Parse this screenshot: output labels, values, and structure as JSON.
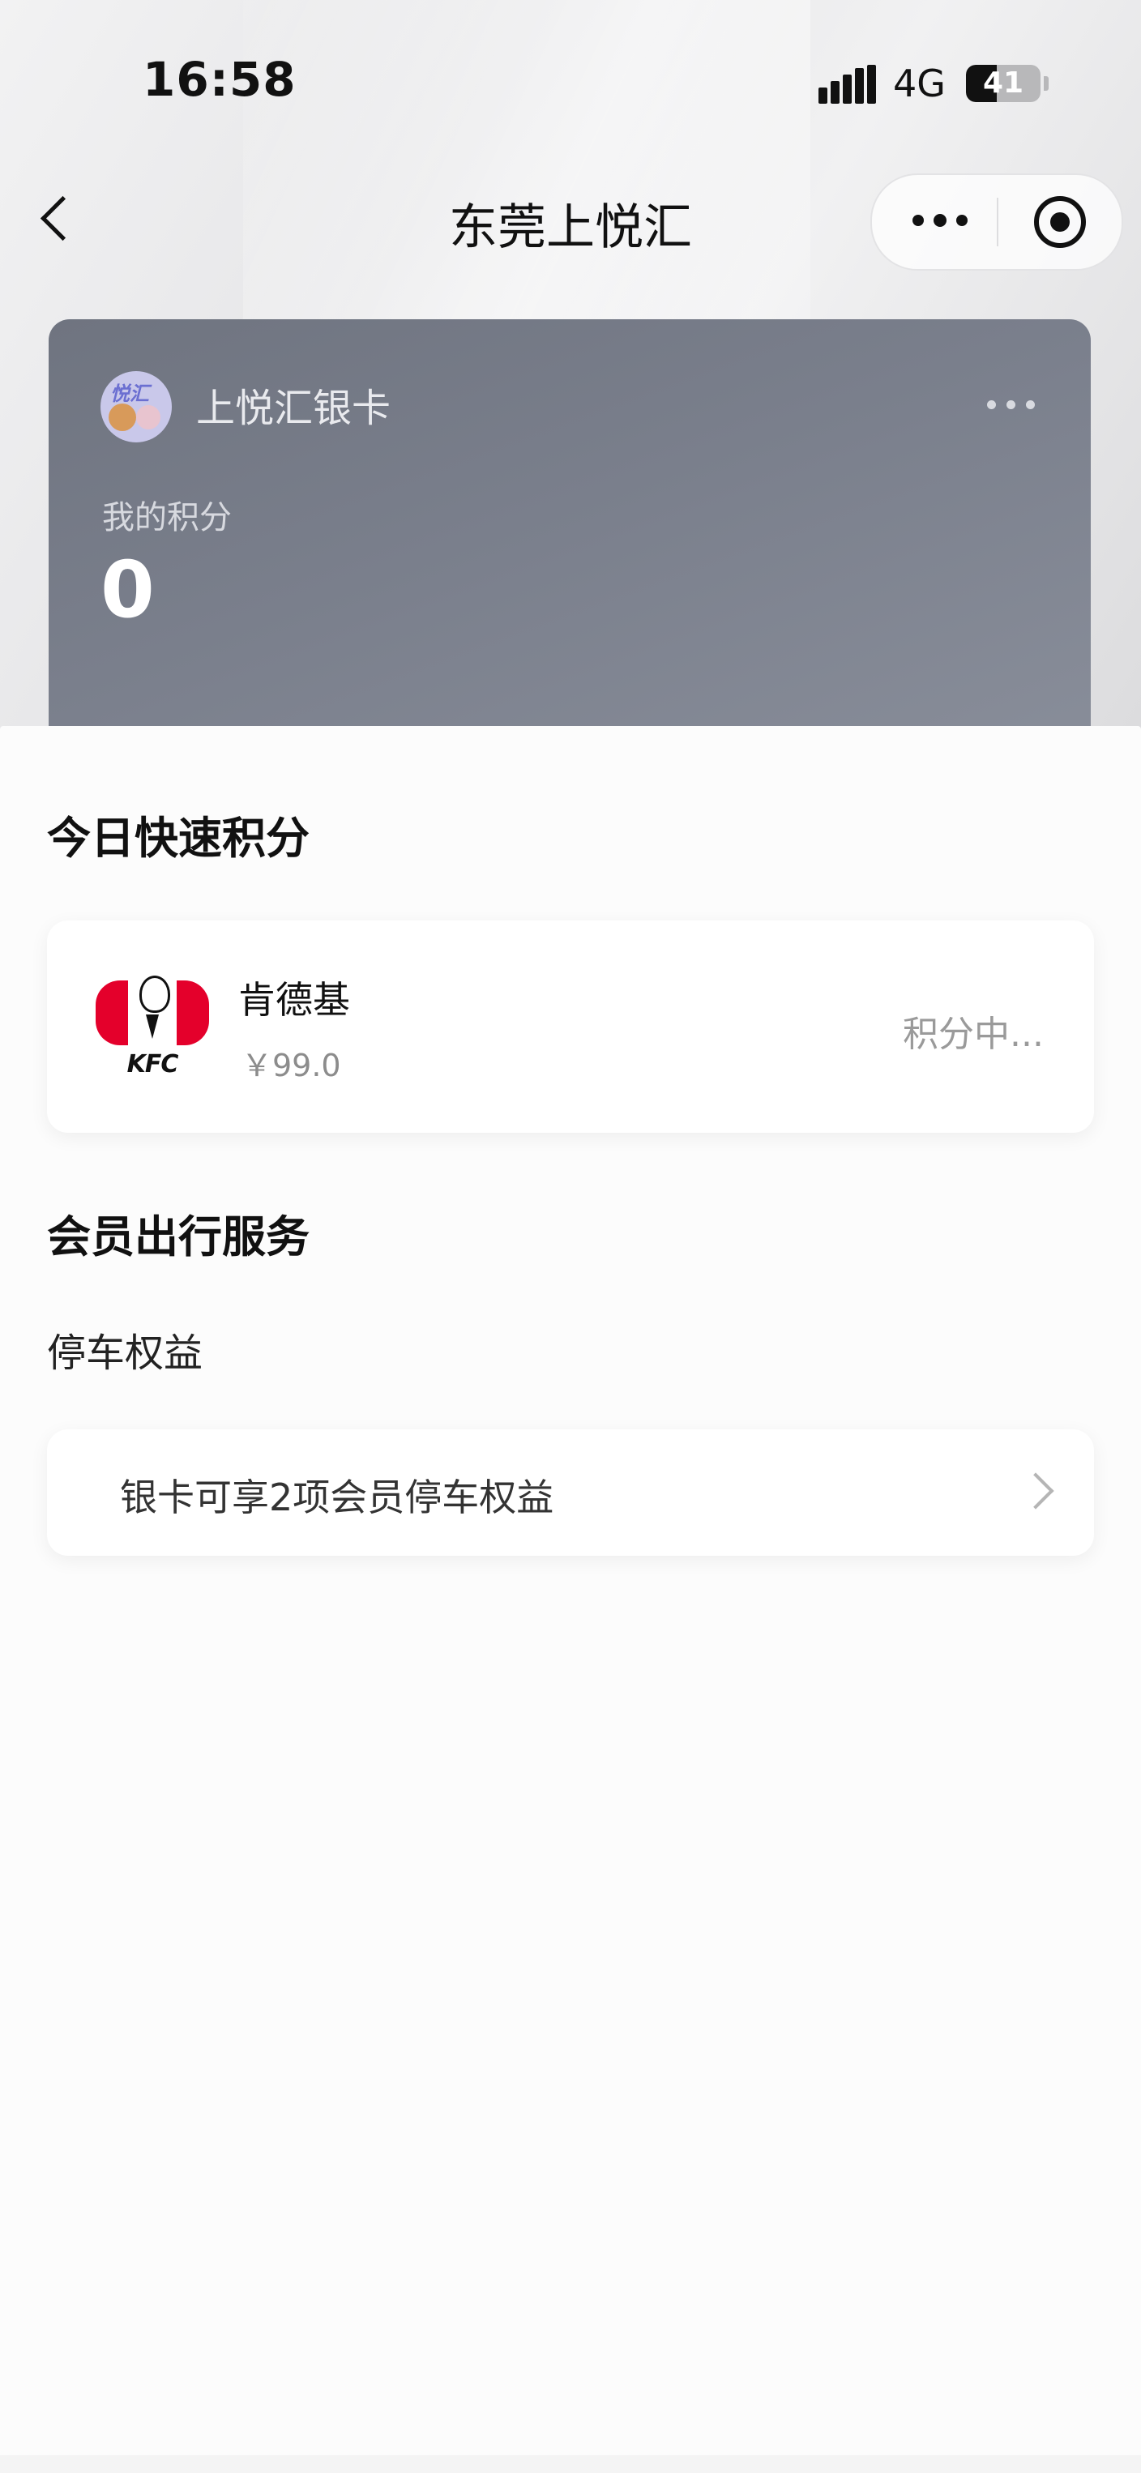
{
  "status_bar": {
    "time": "16:58",
    "network": "4G",
    "battery": "41",
    "battery_fraction": 0.41
  },
  "nav": {
    "title": "东莞上悦汇",
    "back_icon": "chevron-left-icon",
    "more_icon": "more-dots-icon",
    "close_icon": "target-icon"
  },
  "member_card": {
    "logo_text": "悦汇",
    "name": "上悦汇银卡",
    "points_label": "我的积分",
    "points_value": "0",
    "background_color": "#767b87"
  },
  "quick_points": {
    "title": "今日快速积分",
    "items": [
      {
        "logo_brand": "KFC",
        "name": "肯德基",
        "amount": "￥99.0",
        "status": "积分中..."
      }
    ]
  },
  "travel_services": {
    "title": "会员出行服务",
    "subtitle": "停车权益",
    "parking_link": "银卡可享2项会员停车权益"
  },
  "colors": {
    "kfc_red": "#e4002b",
    "text_primary": "#111111",
    "text_secondary": "#8c8c8c"
  }
}
